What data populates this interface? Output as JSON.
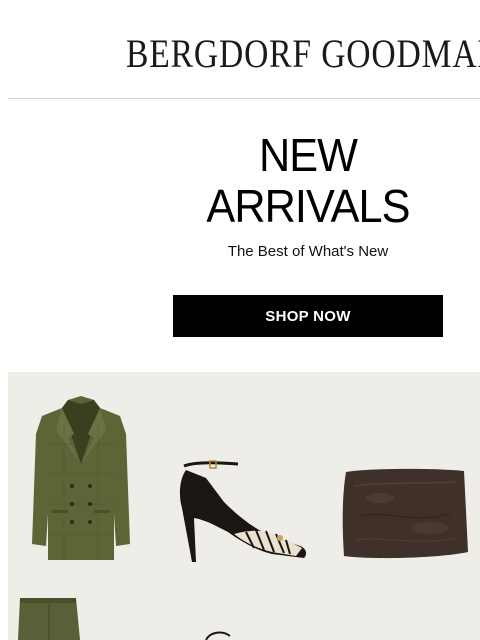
{
  "header": {
    "logo_text": "BERGDORF GOODMAN"
  },
  "hero": {
    "headline_line1": "NEW",
    "headline_line2": "ARRIVALS",
    "subtitle": "The Best of What's New",
    "cta_label": "SHOP NOW"
  },
  "products": [
    {
      "name": "plaid-blazer-image",
      "color": "#5d6436"
    },
    {
      "name": "ankle-strap-pump-image",
      "color": "#1c1612"
    },
    {
      "name": "leather-clutch-image",
      "color": "#3f3029"
    },
    {
      "name": "trousers-image",
      "color": "#5b5f37"
    }
  ],
  "colors": {
    "cta_bg": "#000000",
    "panel_bg": "#eeede7",
    "divider": "#d4d4d4"
  }
}
